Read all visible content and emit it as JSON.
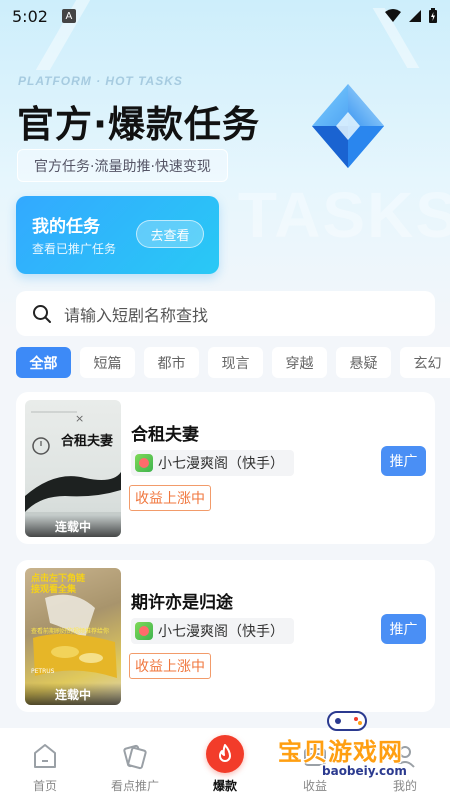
{
  "status": {
    "time": "5:02",
    "notification_glyph": "A"
  },
  "hero": {
    "platform_text": "PLATFORM · HOT TASKS",
    "title": "官方·爆款任务",
    "subtitle": "官方任务·流量助推·快速变现",
    "bg_text": "TASKS"
  },
  "my_task": {
    "title": "我的任务",
    "subtitle": "查看已推广任务",
    "button": "去查看"
  },
  "search": {
    "placeholder": "请输入短剧名称查找"
  },
  "categories": [
    {
      "label": "全部",
      "active": true
    },
    {
      "label": "短篇"
    },
    {
      "label": "都市"
    },
    {
      "label": "现言"
    },
    {
      "label": "穿越"
    },
    {
      "label": "悬疑"
    },
    {
      "label": "玄幻"
    }
  ],
  "tasks": [
    {
      "title": "合租夫妻",
      "cover_title": "合租夫妻",
      "cover_mark": "×",
      "source": "小七漫爽阁（快手）",
      "tag": "收益上涨中",
      "status_badge": "连载中",
      "button": "推广"
    },
    {
      "title": "期许亦是归途",
      "cover_caption": "点击左下角链接观看全集",
      "cover_caption2": "查看前期刷好的视频推荐给你",
      "cover_brand": "PETRUS",
      "source": "小七漫爽阁（快手）",
      "tag": "收益上涨中",
      "status_badge": "连载中",
      "button": "推广"
    }
  ],
  "tabbar": [
    {
      "label": "首页",
      "icon": "home-icon"
    },
    {
      "label": "看点推广",
      "icon": "cards-icon"
    },
    {
      "label": "爆款",
      "icon": "flame-icon",
      "active": true
    },
    {
      "label": "收益",
      "icon": "wallet-icon"
    },
    {
      "label": "我的",
      "icon": "user-icon"
    }
  ],
  "watermark": {
    "title": "宝贝游戏网",
    "url": "baobeiy.com"
  },
  "colors": {
    "accent": "#3d8af7",
    "flame": "#f23c2a",
    "tag": "#f0773e",
    "watermark": "#ff9f12"
  }
}
